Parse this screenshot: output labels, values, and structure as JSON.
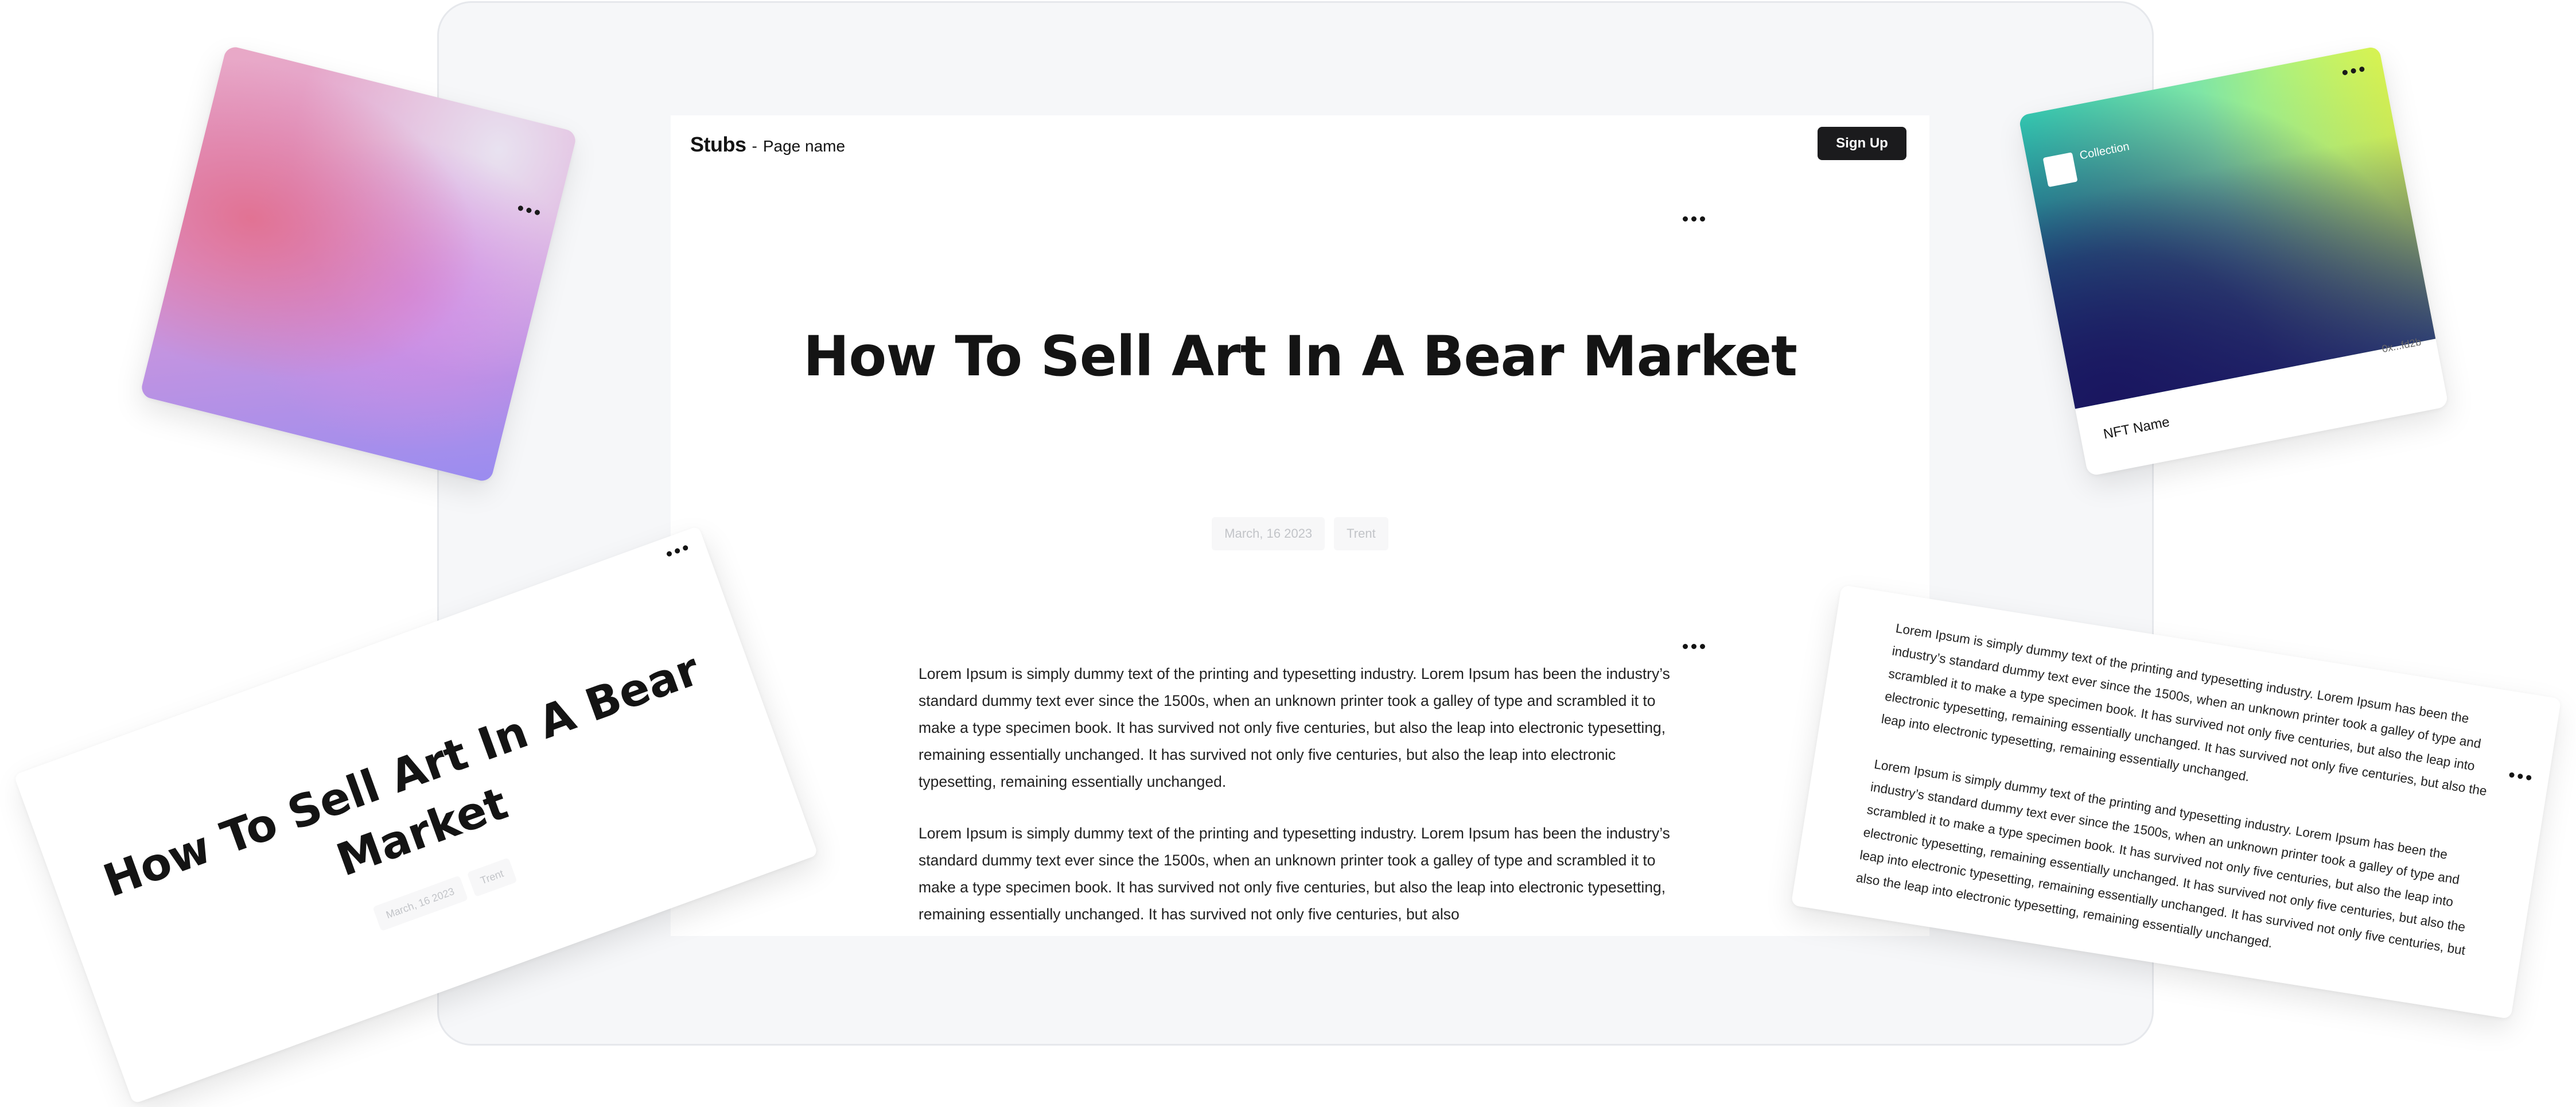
{
  "page": {
    "brand": "Stubs",
    "separator": "-",
    "page_name": "Page name",
    "signup_label": "Sign Up",
    "title": "How To Sell Art In A Bear Market",
    "date": "March, 16 2023",
    "author": "Trent",
    "paragraphs": [
      "Lorem Ipsum is simply dummy text of the printing and typesetting industry. Lorem Ipsum has been the industry’s standard dummy text ever since the 1500s, when an unknown printer took a galley of type and scrambled it to make a type specimen book. It has survived not only five centuries, but also the leap into electronic typesetting, remaining essentially unchanged. It has survived not only five centuries, but also the leap into electronic typesetting, remaining essentially unchanged.",
      "Lorem Ipsum is simply dummy text of the printing and typesetting industry. Lorem Ipsum has been the industry’s standard dummy text ever since the 1500s, when an unknown printer took a galley of type and scrambled it to make a type specimen book. It has survived not only five centuries, but also the leap into electronic typesetting, remaining essentially unchanged. It has survived not only five centuries, but also"
    ]
  },
  "nft_card": {
    "collection": "Collection",
    "address": "0x...fd2b",
    "name": "NFT Name"
  },
  "article_card": {
    "title": "How To Sell Art In A Bear Market",
    "date": "March, 16 2023",
    "author": "Trent"
  },
  "text_card": {
    "paragraphs": [
      "Lorem Ipsum is simply dummy text of the printing and typesetting industry. Lorem Ipsum has been the industry’s standard dummy text ever since the 1500s, when an unknown printer took a galley of type and scrambled it to make a type specimen book. It has survived not only five centuries, but also the leap into electronic typesetting, remaining essentially unchanged. It has survived not only five centuries, but also the leap into electronic typesetting, remaining essentially unchanged.",
      "Lorem Ipsum is simply dummy text of the printing and typesetting industry. Lorem Ipsum has been the industry’s standard dummy text ever since the 1500s, when an unknown printer took a galley of type and scrambled it to make a type specimen book. It has survived not only five centuries, but also the leap into electronic typesetting, remaining essentially unchanged. It has survived not only five centuries, but also the leap into electronic typesetting, remaining essentially unchanged. It has survived not only five centuries, but also the leap into electronic typesetting, remaining essentially unchanged."
    ]
  },
  "icons": [
    "more-icon"
  ]
}
